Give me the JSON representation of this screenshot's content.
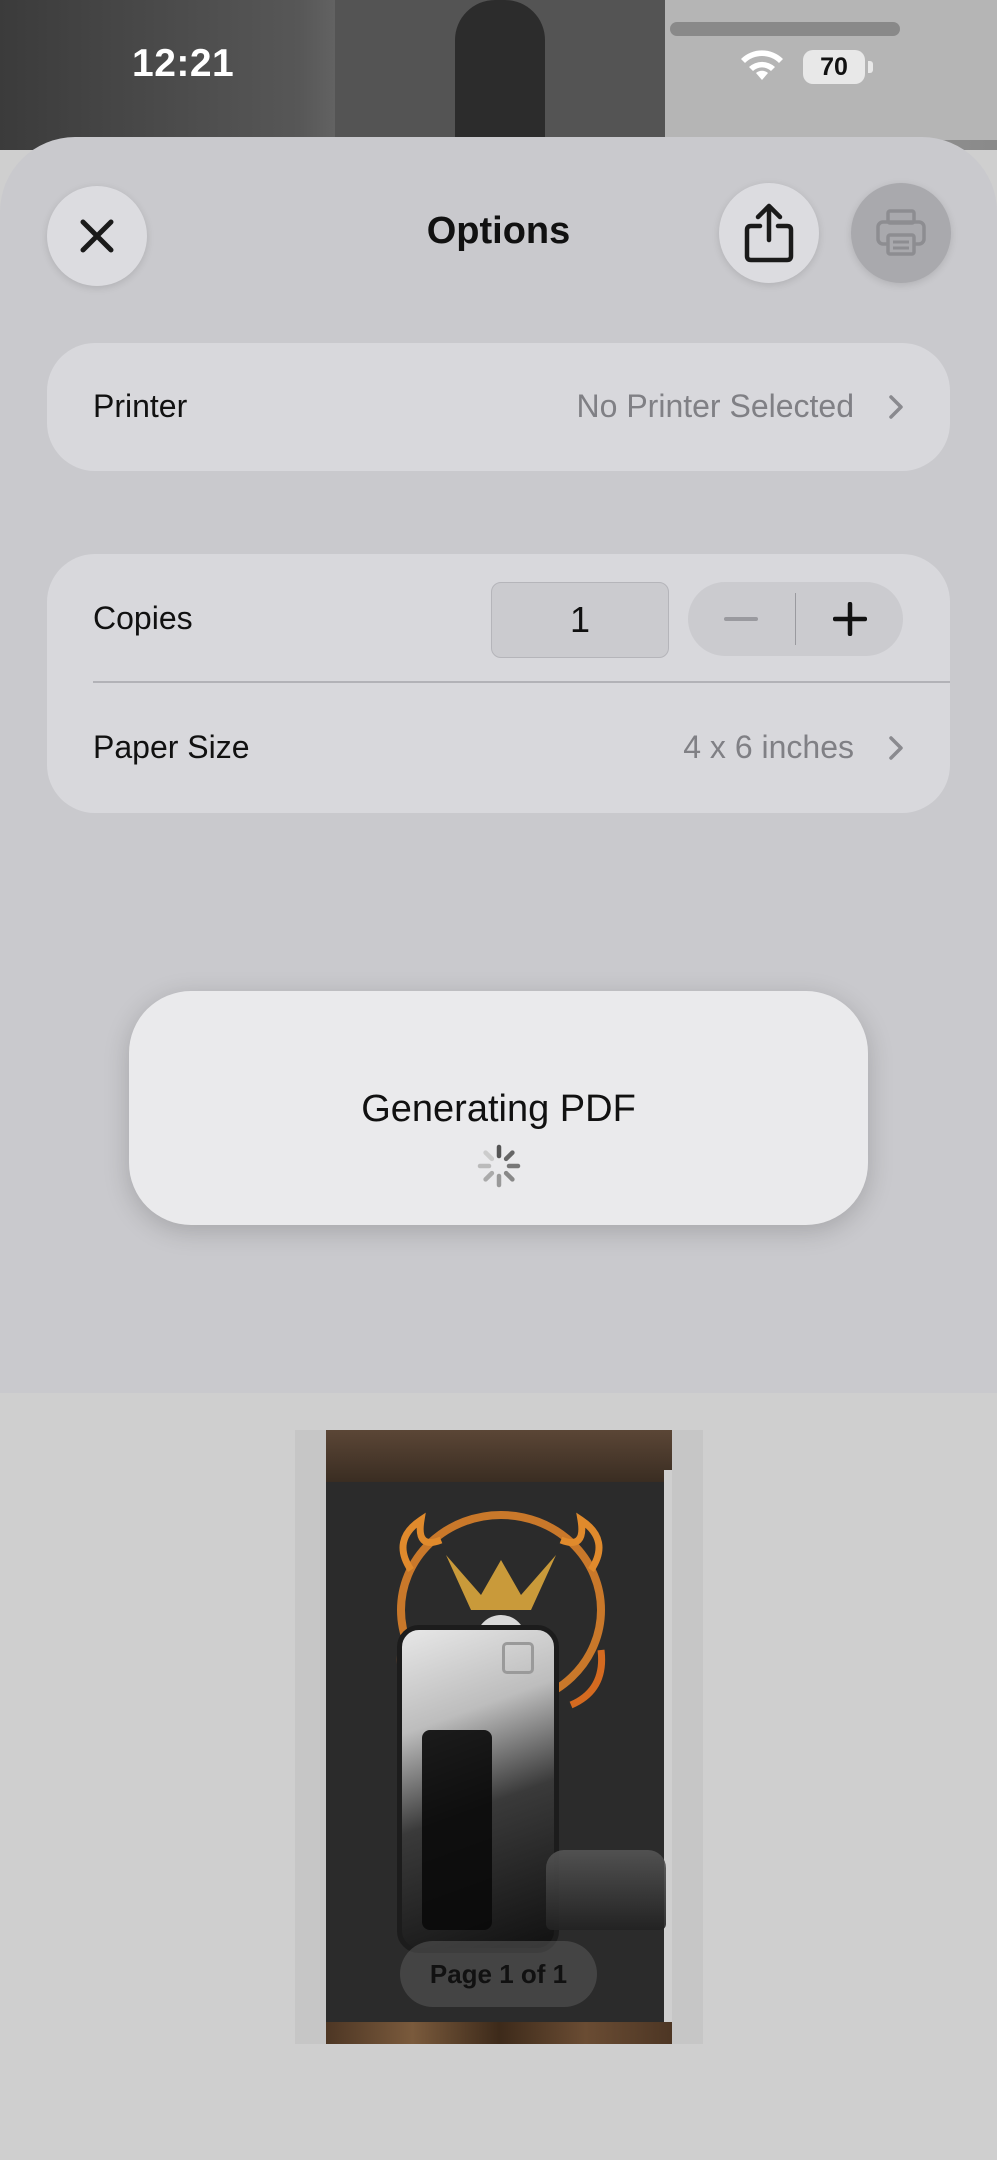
{
  "status_bar": {
    "time": "12:21",
    "battery": "70"
  },
  "header": {
    "title": "Options",
    "close_icon": "close-icon",
    "share_icon": "share-icon",
    "print_icon": "printer-icon"
  },
  "printer_row": {
    "label": "Printer",
    "value": "No Printer Selected"
  },
  "copies_row": {
    "label": "Copies",
    "value": "1",
    "decrement_icon": "minus-icon",
    "increment_icon": "plus-icon"
  },
  "paper_size_row": {
    "label": "Paper Size",
    "value": "4 x 6 inches"
  },
  "hud": {
    "title": "Generating PDF"
  },
  "preview": {
    "page_indicator": "Page 1 of 1"
  }
}
